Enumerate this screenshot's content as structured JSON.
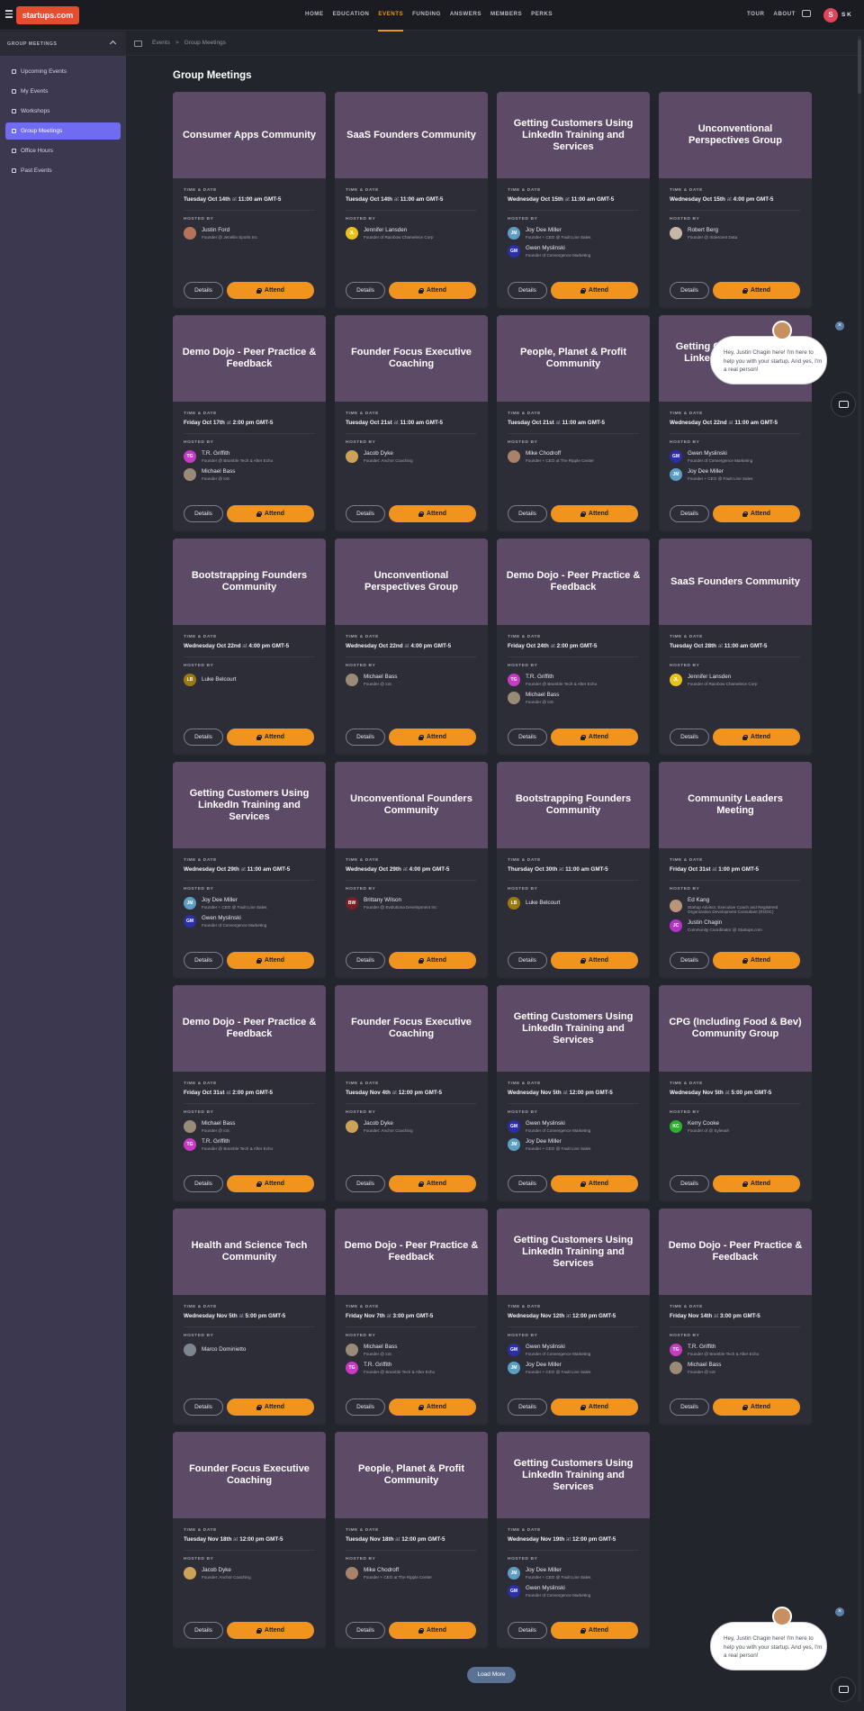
{
  "header": {
    "logo": "startups.com",
    "nav": [
      "HOME",
      "EDUCATION",
      "EVENTS",
      "FUNDING",
      "ANSWERS",
      "MEMBERS",
      "PERKS"
    ],
    "active_nav": "EVENTS",
    "right_nav": [
      "TOUR",
      "ABOUT"
    ],
    "avatar_letter": "S",
    "user_initials": "S K",
    "accent": "#f0941f"
  },
  "sidebar": {
    "section": "GROUP MEETINGS",
    "items": [
      "Upcoming Events",
      "My Events",
      "Workshops",
      "Group Meetings",
      "Office Hours",
      "Past Events"
    ],
    "active": "Group Meetings"
  },
  "breadcrumb": {
    "root": "Events",
    "sep": ">",
    "current": "Group Meetings"
  },
  "page": {
    "title": "Group Meetings",
    "labels": {
      "time": "TIME & DATE",
      "hosted": "HOSTED BY",
      "at": "at",
      "details": "Details",
      "attend": "Attend"
    },
    "load_more": "Load More"
  },
  "chat": {
    "message": "Hey, Justin Chagin here! I'm here to help you with your startup. And yes, I'm a real person!",
    "close": "×"
  },
  "cards": [
    {
      "title": "Consumer Apps Community",
      "day": "Tuesday Oct 14th",
      "time": "11:00 am GMT-5",
      "hosts": [
        {
          "name": "Justin Ford",
          "role": "Founder @ Jenellin Sports Inc",
          "init": "",
          "color": "#b5745a"
        }
      ]
    },
    {
      "title": "SaaS Founders Community",
      "day": "Tuesday Oct 14th",
      "time": "11:00 am GMT-5",
      "hosts": [
        {
          "name": "Jennifer Lansden",
          "role": "Founder of Rainbow Chameleon Corp",
          "init": "JL",
          "color": "#e8c21b"
        }
      ]
    },
    {
      "title": "Getting Customers Using LinkedIn Training and Services",
      "day": "Wednesday Oct 15th",
      "time": "11:00 am GMT-5",
      "hosts": [
        {
          "name": "Joy Dee Miller",
          "role": "Founder + CEO @ Fault Line Sales",
          "init": "JM",
          "color": "#5c9fc2"
        },
        {
          "name": "Gwen Myslinski",
          "role": "Founder of Convergence Marketing",
          "init": "GM",
          "color": "#2b2fa8"
        }
      ]
    },
    {
      "title": "Unconventional Perspectives Group",
      "day": "Wednesday Oct 15th",
      "time": "4:00 pm GMT-5",
      "hosts": [
        {
          "name": "Robert Berg",
          "role": "Founder @ Iridescent Data",
          "init": "",
          "color": "#c7b6a8"
        }
      ]
    },
    {
      "title": "Demo Dojo - Peer Practice & Feedback",
      "day": "Friday Oct 17th",
      "time": "2:00 pm GMT-5",
      "hosts": [
        {
          "name": "T.R. Griffith",
          "role": "Founder @ Bramble Tech & After Echo",
          "init": "TG",
          "color": "#c63bc3"
        },
        {
          "name": "Michael Bass",
          "role": "Founder @ ioS",
          "init": "",
          "color": "#9a8b78"
        }
      ]
    },
    {
      "title": "Founder Focus Executive Coaching",
      "day": "Tuesday Oct 21st",
      "time": "11:00 am GMT-5",
      "hosts": [
        {
          "name": "Jacob Dyke",
          "role": "Founder: Anchor Coaching",
          "init": "",
          "color": "#caa25a"
        }
      ]
    },
    {
      "title": "People, Planet & Profit Community",
      "day": "Tuesday Oct 21st",
      "time": "11:00 am GMT-5",
      "hosts": [
        {
          "name": "Mike Chodroff",
          "role": "Founder + CEO at The Ripple Center",
          "init": "",
          "color": "#a8826a"
        }
      ]
    },
    {
      "title": "Getting Customers Using LinkedIn Training and Services",
      "day": "Wednesday Oct 22nd",
      "time": "11:00 am GMT-5",
      "hosts": [
        {
          "name": "Gwen Myslinski",
          "role": "Founder of Convergence Marketing",
          "init": "GM",
          "color": "#2b2fa8"
        },
        {
          "name": "Joy Dee Miller",
          "role": "Founder + CEO @ Fault Line Sales",
          "init": "JM",
          "color": "#5c9fc2"
        }
      ]
    },
    {
      "title": "Bootstrapping Founders Community",
      "day": "Wednesday Oct 22nd",
      "time": "4:00 pm GMT-5",
      "hosts": [
        {
          "name": "Luke Belcourt",
          "role": "",
          "init": "LB",
          "color": "#9c7a12"
        }
      ]
    },
    {
      "title": "Unconventional Perspectives Group",
      "day": "Wednesday Oct 22nd",
      "time": "4:00 pm GMT-5",
      "hosts": [
        {
          "name": "Michael Bass",
          "role": "Founder @ ioS",
          "init": "",
          "color": "#9a8b78"
        }
      ]
    },
    {
      "title": "Demo Dojo - Peer Practice & Feedback",
      "day": "Friday Oct 24th",
      "time": "2:00 pm GMT-5",
      "hosts": [
        {
          "name": "T.R. Griffith",
          "role": "Founder @ Bramble Tech & After Echo",
          "init": "TG",
          "color": "#c63bc3"
        },
        {
          "name": "Michael Bass",
          "role": "Founder @ ioS",
          "init": "",
          "color": "#9a8b78"
        }
      ]
    },
    {
      "title": "SaaS Founders Community",
      "day": "Tuesday Oct 28th",
      "time": "11:00 am GMT-5",
      "hosts": [
        {
          "name": "Jennifer Lansden",
          "role": "Founder of Rainbow Chameleon Corp",
          "init": "JL",
          "color": "#e8c21b"
        }
      ]
    },
    {
      "title": "Getting Customers Using LinkedIn Training and Services",
      "day": "Wednesday Oct 29th",
      "time": "11:00 am GMT-5",
      "hosts": [
        {
          "name": "Joy Dee Miller",
          "role": "Founder + CEO @ Fault Line Sales",
          "init": "JM",
          "color": "#5c9fc2"
        },
        {
          "name": "Gwen Myslinski",
          "role": "Founder of Convergence Marketing",
          "init": "GM",
          "color": "#2b2fa8"
        }
      ]
    },
    {
      "title": "Unconventional Founders Community",
      "day": "Wednesday Oct 29th",
      "time": "4:00 pm GMT-5",
      "hosts": [
        {
          "name": "Brittany Wilson",
          "role": "Founder @ Evolutiona Development Inc",
          "init": "BW",
          "color": "#7a1f24"
        }
      ]
    },
    {
      "title": "Bootstrapping Founders Community",
      "day": "Thursday Oct 30th",
      "time": "11:00 am GMT-5",
      "hosts": [
        {
          "name": "Luke Belcourt",
          "role": "",
          "init": "LB",
          "color": "#9c7a12"
        }
      ]
    },
    {
      "title": "Community Leaders Meeting",
      "day": "Friday Oct 31st",
      "time": "1:00 pm GMT-5",
      "hosts": [
        {
          "name": "Ed Kang",
          "role": "Startup Advisor, Executive Coach and Registered Organization Development Consultant (RODC)",
          "init": "",
          "color": "#b89478"
        },
        {
          "name": "Justin Chagin",
          "role": "Community Coordinator @ Startups.com",
          "init": "JC",
          "color": "#b533c9"
        }
      ]
    },
    {
      "title": "Demo Dojo - Peer Practice & Feedback",
      "day": "Friday Oct 31st",
      "time": "2:00 pm GMT-5",
      "hosts": [
        {
          "name": "Michael Bass",
          "role": "Founder @ ioS",
          "init": "",
          "color": "#9a8b78"
        },
        {
          "name": "T.R. Griffith",
          "role": "Founder @ Bramble Tech & After Echo",
          "init": "TG",
          "color": "#c63bc3"
        }
      ]
    },
    {
      "title": "Founder Focus Executive Coaching",
      "day": "Tuesday Nov 4th",
      "time": "12:00 pm GMT-5",
      "hosts": [
        {
          "name": "Jacob Dyke",
          "role": "Founder: Anchor Coaching",
          "init": "",
          "color": "#caa25a"
        }
      ]
    },
    {
      "title": "Getting Customers Using LinkedIn Training and Services",
      "day": "Wednesday Nov 5th",
      "time": "12:00 pm GMT-5",
      "hosts": [
        {
          "name": "Gwen Myslinski",
          "role": "Founder of Convergence Marketing",
          "init": "GM",
          "color": "#2b2fa8"
        },
        {
          "name": "Joy Dee Miller",
          "role": "Founder + CEO @ Fault Line Sales",
          "init": "JM",
          "color": "#5c9fc2"
        }
      ]
    },
    {
      "title": "CPG (Including Food & Bev) Community Group",
      "day": "Wednesday Nov 5th",
      "time": "5:00 pm GMT-5",
      "hosts": [
        {
          "name": "Kerry Cooke",
          "role": "Founder of @ Sylenah",
          "init": "KC",
          "color": "#2fae2f"
        }
      ]
    },
    {
      "title": "Health and Science Tech Community",
      "day": "Wednesday Nov 5th",
      "time": "5:00 pm GMT-5",
      "hosts": [
        {
          "name": "Marco Dominietto",
          "role": "",
          "init": "",
          "color": "#7d8590"
        }
      ]
    },
    {
      "title": "Demo Dojo - Peer Practice & Feedback",
      "day": "Friday Nov 7th",
      "time": "3:00 pm GMT-5",
      "hosts": [
        {
          "name": "Michael Bass",
          "role": "Founder @ ioS",
          "init": "",
          "color": "#9a8b78"
        },
        {
          "name": "T.R. Griffith",
          "role": "Founder @ Bramble Tech & After Echo",
          "init": "TG",
          "color": "#c63bc3"
        }
      ]
    },
    {
      "title": "Getting Customers Using LinkedIn Training and Services",
      "day": "Wednesday Nov 12th",
      "time": "12:00 pm GMT-5",
      "hosts": [
        {
          "name": "Gwen Myslinski",
          "role": "Founder of Convergence Marketing",
          "init": "GM",
          "color": "#2b2fa8"
        },
        {
          "name": "Joy Dee Miller",
          "role": "Founder + CEO @ Fault Line Sales",
          "init": "JM",
          "color": "#5c9fc2"
        }
      ]
    },
    {
      "title": "Demo Dojo - Peer Practice & Feedback",
      "day": "Friday Nov 14th",
      "time": "3:00 pm GMT-5",
      "hosts": [
        {
          "name": "T.R. Griffith",
          "role": "Founder @ Bramble Tech & After Echo",
          "init": "TG",
          "color": "#c63bc3"
        },
        {
          "name": "Michael Bass",
          "role": "Founder @ ioS",
          "init": "",
          "color": "#9a8b78"
        }
      ]
    },
    {
      "title": "Founder Focus Executive Coaching",
      "day": "Tuesday Nov 18th",
      "time": "12:00 pm GMT-5",
      "hosts": [
        {
          "name": "Jacob Dyke",
          "role": "Founder: Anchor Coaching",
          "init": "",
          "color": "#caa25a"
        }
      ]
    },
    {
      "title": "People, Planet & Profit Community",
      "day": "Tuesday Nov 18th",
      "time": "12:00 pm GMT-5",
      "hosts": [
        {
          "name": "Mike Chodroff",
          "role": "Founder + CEO at The Ripple Center",
          "init": "",
          "color": "#a8826a"
        }
      ]
    },
    {
      "title": "Getting Customers Using LinkedIn Training and Services",
      "day": "Wednesday Nov 19th",
      "time": "12:00 pm GMT-5",
      "hosts": [
        {
          "name": "Joy Dee Miller",
          "role": "Founder + CEO @ Fault Line Sales",
          "init": "JM",
          "color": "#5c9fc2"
        },
        {
          "name": "Gwen Myslinski",
          "role": "Founder of Convergence Marketing",
          "init": "GM",
          "color": "#2b2fa8"
        }
      ]
    }
  ]
}
